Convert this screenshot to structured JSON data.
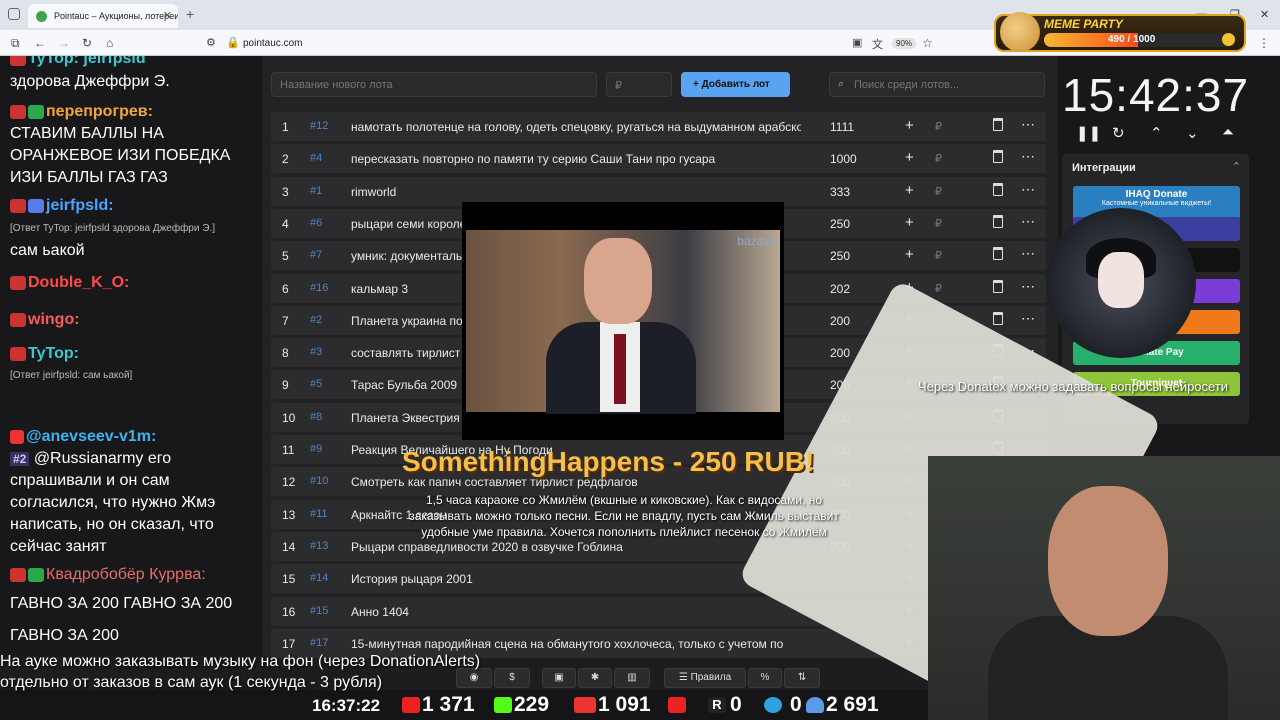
{
  "browser": {
    "tab_title": "Pointauc – Аукционы, лотереи",
    "url": "pointauc.com",
    "zoom": "90%"
  },
  "meme_party": {
    "title": "MEME PARTY",
    "counter": "490 / 1000",
    "progress": 0.49
  },
  "chat": {
    "messages": [
      {
        "user": "TyTop:",
        "text": "jeirfpsld",
        "user_color": "#3cc8d0"
      },
      {
        "user": "",
        "text": "здорова Джеффри Э."
      },
      {
        "user": "перепрогрев:",
        "text": "СТАВИМ БАЛЛЫ НА ОРАНЖЕВОЕ ИЗИ ПОБЕДКА ИЗИ БАЛЛЫ ГАЗ ГАЗ",
        "user_color": "#f3a53a"
      },
      {
        "user": "jeirfpsld:",
        "text": "",
        "user_color": "#4aa3ff"
      },
      {
        "user": "",
        "text": "[Ответ TyTop: jeirfpsld здорова Джеффри Э.]",
        "sub": true
      },
      {
        "user": "",
        "text": "сам ьакой"
      },
      {
        "user": "Double_K_O:",
        "text": "",
        "user_color": "#ff4a4a"
      },
      {
        "user": "wingo:",
        "text": "",
        "user_color": "#ff5a5a"
      },
      {
        "user": "TyTop:",
        "text": "",
        "user_color": "#3cc8d0"
      },
      {
        "user": "",
        "text": "[Ответ jeirfpsld: сам ьакой]",
        "sub": true
      },
      {
        "user": "@anevseev-v1m:",
        "text": "",
        "user_color": "#3cb3f0"
      },
      {
        "user": "#2",
        "text": "@Russianarmy его спрашивали и он сам согласился, что нужно Жмэ написать, но он сказал, что сейчас занят"
      },
      {
        "user": "Квадробобёр Куррва:",
        "text": "ГАВНО ЗА 200 ГАВНО ЗА 200 ГАВНО ЗА 200",
        "user_color": "#e86b6b"
      }
    ]
  },
  "auction": {
    "lot_placeholder": "Название нового лота",
    "amount_placeholder": "₽",
    "add_label": "Добавить лот",
    "search_placeholder": "Поиск среди лотов...",
    "currency": "₽",
    "rows": [
      {
        "n": "1",
        "id": "#12",
        "name": "намотать полотенце на голову, одеть спецовку, ругаться на выдуманном арабском",
        "amount": "1111"
      },
      {
        "n": "2",
        "id": "#4",
        "name": "пересказать повторно по памяти ту серию Саши Тани про гусара",
        "amount": "1000"
      },
      {
        "n": "3",
        "id": "#1",
        "name": "rimworld",
        "amount": "333"
      },
      {
        "n": "4",
        "id": "#6",
        "name": "рыцари семи королевств",
        "amount": "250"
      },
      {
        "n": "5",
        "id": "#7",
        "name": "умник: документальный",
        "amount": "250"
      },
      {
        "n": "6",
        "id": "#16",
        "name": "кальмар 3",
        "amount": "202"
      },
      {
        "n": "7",
        "id": "#2",
        "name": "Планета украина под",
        "amount": "200"
      },
      {
        "n": "8",
        "id": "#3",
        "name": "составлять тирлист",
        "amount": "200"
      },
      {
        "n": "9",
        "id": "#5",
        "name": "Тарас Бульба 2009",
        "amount": "200"
      },
      {
        "n": "10",
        "id": "#8",
        "name": "Планета Эквестрия",
        "amount": "200"
      },
      {
        "n": "11",
        "id": "#9",
        "name": "Реакция Величайшего на Ну Погоди",
        "amount": "200"
      },
      {
        "n": "12",
        "id": "#10",
        "name": "Смотреть как папич составляет тирлист редфлагов",
        "amount": "200"
      },
      {
        "n": "13",
        "id": "#11",
        "name": "Аркнайтс 1 сезон",
        "amount": "200"
      },
      {
        "n": "14",
        "id": "#13",
        "name": "Рыцари справедливости 2020 в озвучке Гоблина",
        "amount": "200"
      },
      {
        "n": "15",
        "id": "#14",
        "name": "История рыцаря 2001",
        "amount": ""
      },
      {
        "n": "16",
        "id": "#15",
        "name": "Анно 1404",
        "amount": ""
      },
      {
        "n": "17",
        "id": "#17",
        "name": "15-минутная пародийная сцена на обманутого хохлочеса, только с учетом по",
        "amount": ""
      }
    ]
  },
  "right": {
    "timer": "15:42:37",
    "integrations_title": "Интеграции",
    "buttons": [
      {
        "label": "IHAQ Donate",
        "sub": "Кастомные уникальные виджеты!",
        "color": "#2a7fc0"
      },
      {
        "label": "er",
        "color": "#3a3fa0"
      },
      {
        "label": "",
        "color": "#111"
      },
      {
        "label": "",
        "color": "#7a3bd8"
      },
      {
        "label": "Alerts",
        "color": "#f07a1a"
      },
      {
        "label": "Donate Pay",
        "color": "#27b06c"
      },
      {
        "label": "Tourniquet",
        "color": "#8fc53a"
      }
    ]
  },
  "overlays": {
    "video_logo": "bazava",
    "alert_title": "SomethingHappens - 250 RUB!",
    "alert_text": "1,5 часа караоке со Жмилём (вкшные и киковские). Как с видосами, но заказывать можно только песни. Если не впадлу, пусть сам Жмиль выставит удобные уме правила. Хочется пополнить плейлист песенок со Жмилём",
    "donatex": "Через Donatex можно задавать вопросы нейросети",
    "bottom_line1": "На ауке можно заказывать музыку на фон (через DonationAlerts)",
    "bottom_line2": "отдельно от заказов в сам аук (1 секунда - 3 рубля)"
  },
  "toolbar": {
    "rules_label": "Правила"
  },
  "stats": {
    "clock": "16:37:22",
    "youtube": "1 371",
    "kick": "229",
    "vk": "1 091",
    "rutube": "0",
    "telegram": "0",
    "viewers": "2 691"
  }
}
